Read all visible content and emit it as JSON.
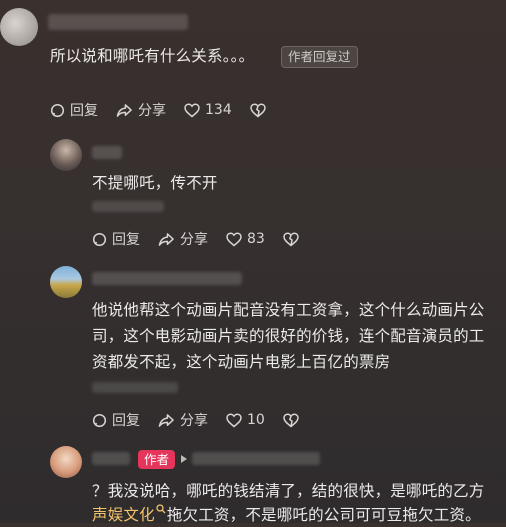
{
  "comments": [
    {
      "text": "所以说和哪吒有什么关系。。。",
      "author_replied_badge": "作者回复过",
      "reply_label": "回复",
      "share_label": "分享",
      "like_count": "134"
    },
    {
      "text": "不提哪吒，传不开",
      "reply_label": "回复",
      "share_label": "分享",
      "like_count": "83"
    },
    {
      "text_lines": [
        "他说他帮这个动画片配音没有工资拿，这个什么动画片公",
        "司，这个电影动画片卖的很好的价钱，连个配音演员的工",
        "资都发不起，这个动画片电影上百亿的票房"
      ],
      "reply_label": "回复",
      "share_label": "分享",
      "like_count": "10"
    },
    {
      "author_badge": "作者",
      "text_line1": "？我没说哈，哪吒的钱结清了，结的很快，是哪吒的乙方",
      "link_text": "声娱文化",
      "text_line2_rest": "拖欠工资，不是哪吒的公司可可豆拖欠工资。"
    }
  ],
  "colors": {
    "author_badge": "#e6355b",
    "link": "#f2c36b",
    "background": "#36302f"
  }
}
